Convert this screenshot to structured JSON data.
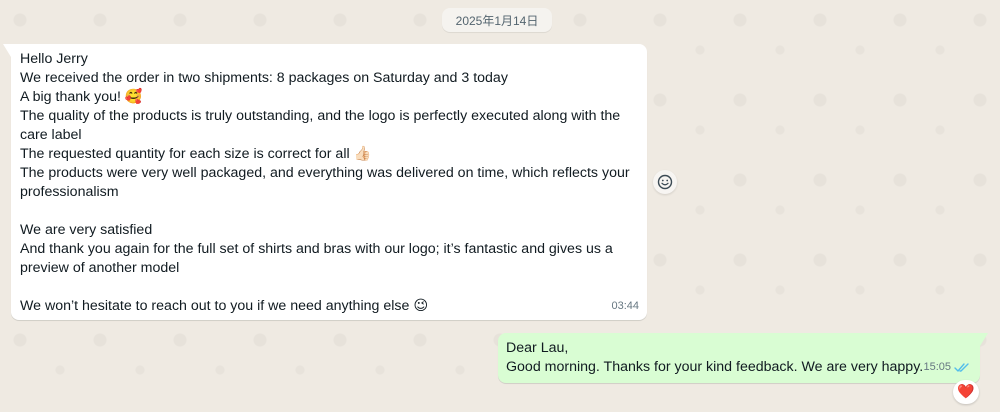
{
  "date_divider": "2025年1月14日",
  "incoming_message": {
    "lines": [
      "Hello Jerry",
      "We received the order in two shipments: 8 packages on Saturday and 3 today",
      "A big thank you!",
      "The quality of the products is truly outstanding, and the logo is perfectly executed along with the",
      "care label",
      "The requested quantity for each size is correct for all",
      "The products were very well packaged, and everything was delivered on time, which reflects your",
      "professionalism",
      "We are very satisfied",
      "And thank you again for the full set of shirts and bras with our logo; it’s fantastic and gives us a",
      "preview of another model",
      "We won’t hesitate to reach out to you if we need anything else"
    ],
    "emojis": {
      "thank_you": "🥰",
      "correct": "👍🏻",
      "closing": "😉"
    },
    "time": "03:44"
  },
  "outgoing_message": {
    "lines": [
      "Dear Lau,",
      "Good morning. Thanks for your kind feedback. We are very happy."
    ],
    "time": "15:05",
    "status_icon": "double-check-read-icon",
    "status_color": "#53bdeb",
    "reaction": "❤️"
  },
  "colors": {
    "background": "#efeae2",
    "incoming_bubble": "#ffffff",
    "outgoing_bubble": "#d9fdd3"
  }
}
